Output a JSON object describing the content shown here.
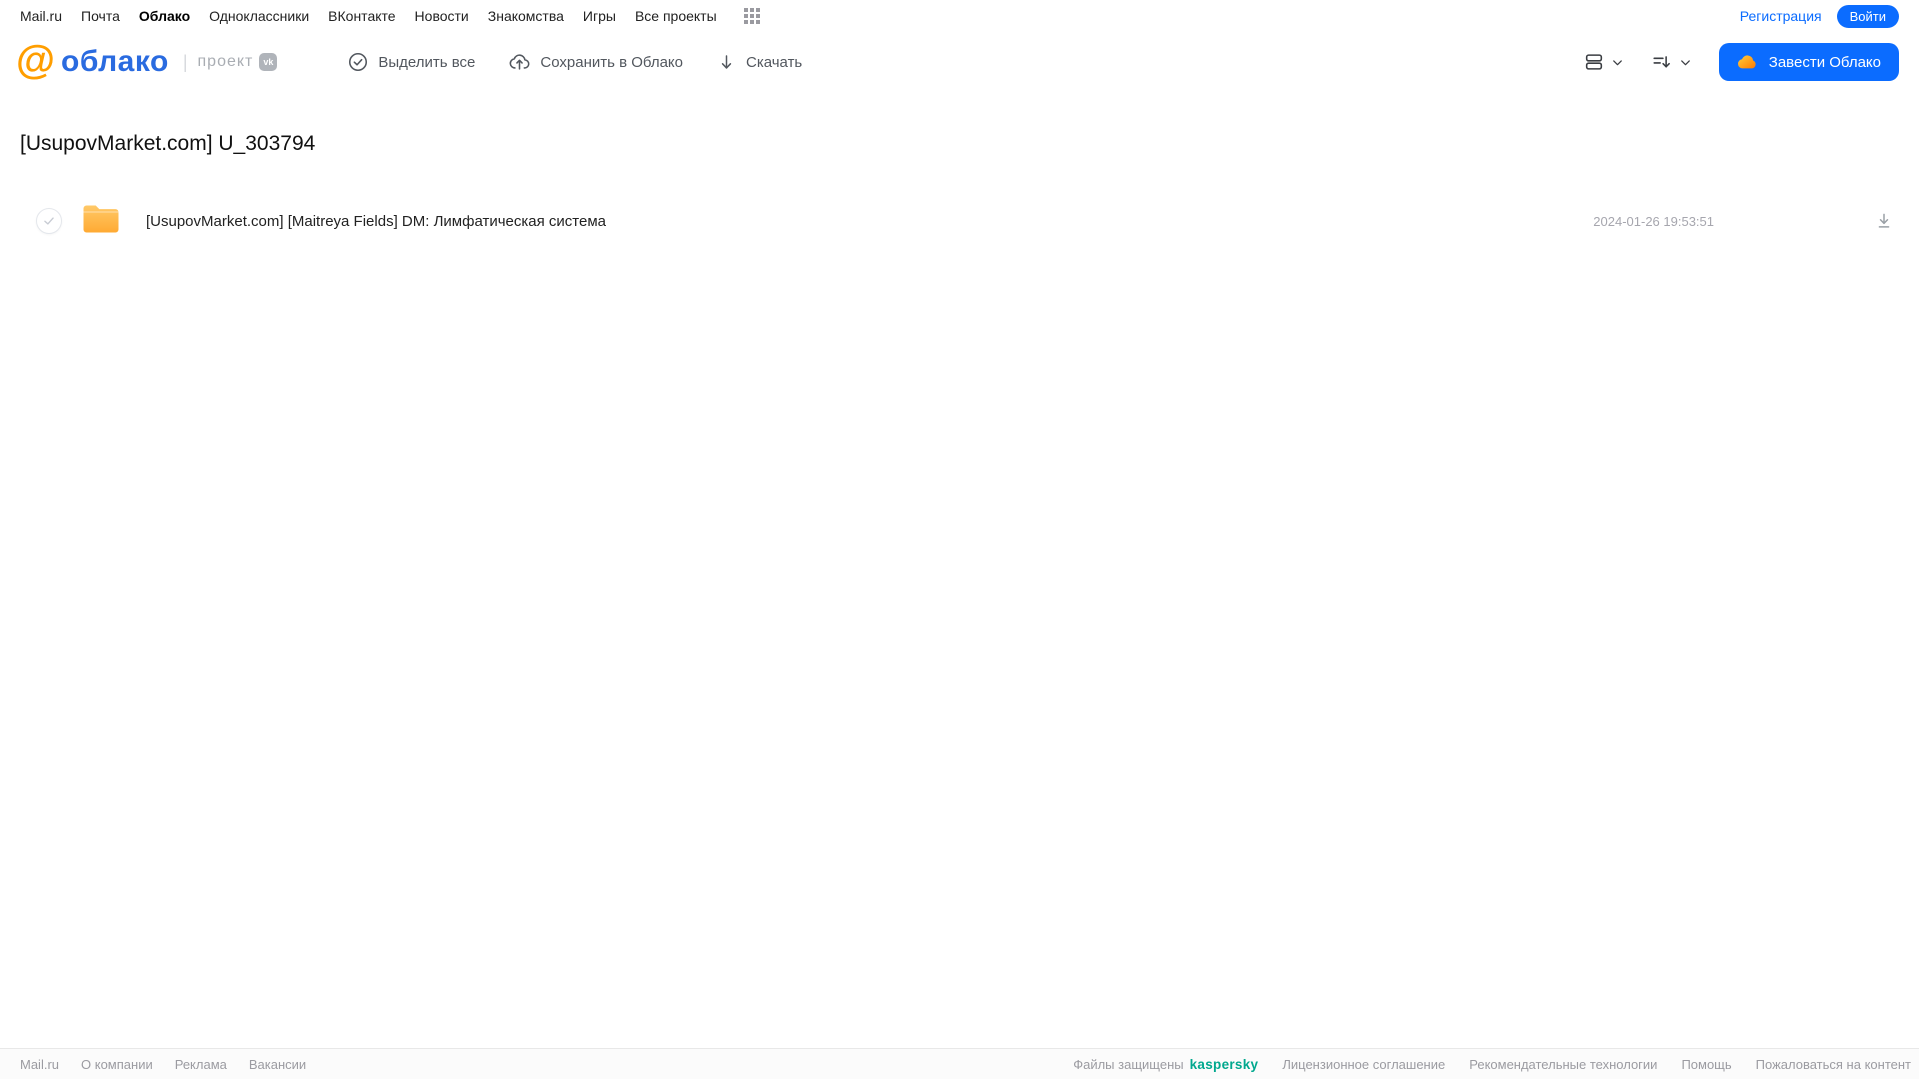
{
  "topnav": {
    "items": [
      {
        "label": "Mail.ru",
        "active": false
      },
      {
        "label": "Почта",
        "active": false
      },
      {
        "label": "Облако",
        "active": true
      },
      {
        "label": "Одноклассники",
        "active": false
      },
      {
        "label": "ВКонтакте",
        "active": false
      },
      {
        "label": "Новости",
        "active": false
      },
      {
        "label": "Знакомства",
        "active": false
      },
      {
        "label": "Игры",
        "active": false
      },
      {
        "label": "Все проекты",
        "active": false
      }
    ],
    "register_label": "Регистрация",
    "login_label": "Войти"
  },
  "header": {
    "logo_at": "@",
    "logo_text": "облако",
    "divider": "|",
    "project_label": "проект",
    "vk_badge": "vk",
    "actions": {
      "select_all": "Выделить все",
      "save_to_cloud": "Сохранить в Облако",
      "download": "Скачать"
    },
    "create_cloud_label": "Завести Облако"
  },
  "main": {
    "title": "[UsupovMarket.com] U_303794",
    "files": [
      {
        "name": "[UsupovMarket.com] [Maitreya Fields] DM: Лимфатическая система",
        "date": "2024-01-26 19:53:51",
        "type": "folder"
      }
    ]
  },
  "footer": {
    "left_links": [
      "Mail.ru",
      "О компании",
      "Реклама",
      "Вакансии"
    ],
    "protected_label": "Файлы защищены",
    "kaspersky_label": "kaspersky",
    "right_links": [
      "Лицензионное соглашение",
      "Рекомендательные технологии",
      "Помощь",
      "Пожаловаться на контент"
    ]
  },
  "icons": {
    "apps-grid-icon": "3x3 dots",
    "check-circle-icon": "circled check",
    "cloud-upload-icon": "cloud with up arrow",
    "download-icon": "down arrow",
    "list-view-icon": "stacked rows",
    "sort-icon": "lines with down arrow",
    "chevron-down-icon": "v",
    "cloud-icon": "orange cloud",
    "folder-icon": "yellow folder",
    "download-underline-icon": "down arrow with base line"
  },
  "colors": {
    "accent": "#0b6cff",
    "logo_orange": "#ff9e00",
    "logo_blue": "#2a6be0",
    "folder_top": "#ffc968",
    "folder_bottom": "#ffaa33",
    "kaspersky_green": "#00a88e"
  }
}
